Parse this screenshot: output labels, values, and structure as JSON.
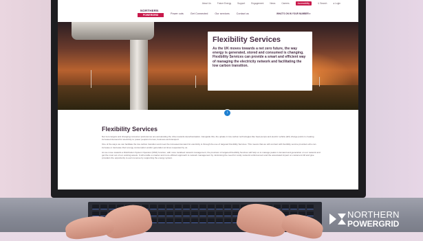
{
  "util_bar": {
    "items": [
      "About Us",
      "Future Energy",
      "Support",
      "Engagement",
      "News",
      "Careers"
    ],
    "accessibility": "Accessibility",
    "search": "Search",
    "login": "Login"
  },
  "nav": {
    "logo_line1": "NORTHERN",
    "logo_line2": "POWERGRID",
    "links": [
      "Power cuts",
      "Get Connected",
      "Our services",
      "Contact us"
    ],
    "postcode": "WHAT'S ON IN YOUR NUMBER"
  },
  "hero": {
    "title": "Flexibility Services",
    "body": "As the UK moves towards a net zero future, the way energy is generated, stored and consumed is changing. Flexibility Services can provide a smart and efficient way of managing the electricity network and facilitating the low carbon transition."
  },
  "scroll_button": "↓",
  "content": {
    "heading": "Flexibility Services",
    "paragraphs": [
      "Net zero targets and changing consumer preferences are accelerating the drive towards decarbonisation. Alongside this, the uptake in low carbon technologies like heat pumps and electric vehicle (EV) charge points is creating increased demand for electricity to power people's homes, business and transport.",
      "One of the ways we can facilitate the low carbon transition and meet the increased demand for electricity is through the use of targeted Flexibility Services. This means that we will contract with flexibility service providers who can increase or decrease their energy consumption and/or generation at times requested by us.",
      "As we move towards a Distribution System Operator (DSO) function, with more localised network management, the provision of targeted Flexibility Services will help us to manage peaks in demand and generation on our network and get the most out of our existing assets. It will enable a smarter and more efficient approach to network management by minimising the need for costly network reinforcement and the associated impact on customers bill and give providers the opportunity to earn revenue by supporting the energy system."
    ]
  },
  "watermark": {
    "line1": "NORTHERN",
    "line2": "POWERGRID"
  },
  "colors": {
    "brand_red": "#c8194b",
    "brand_purple": "#5a3b58",
    "scroll_blue": "#1e7fd0"
  }
}
